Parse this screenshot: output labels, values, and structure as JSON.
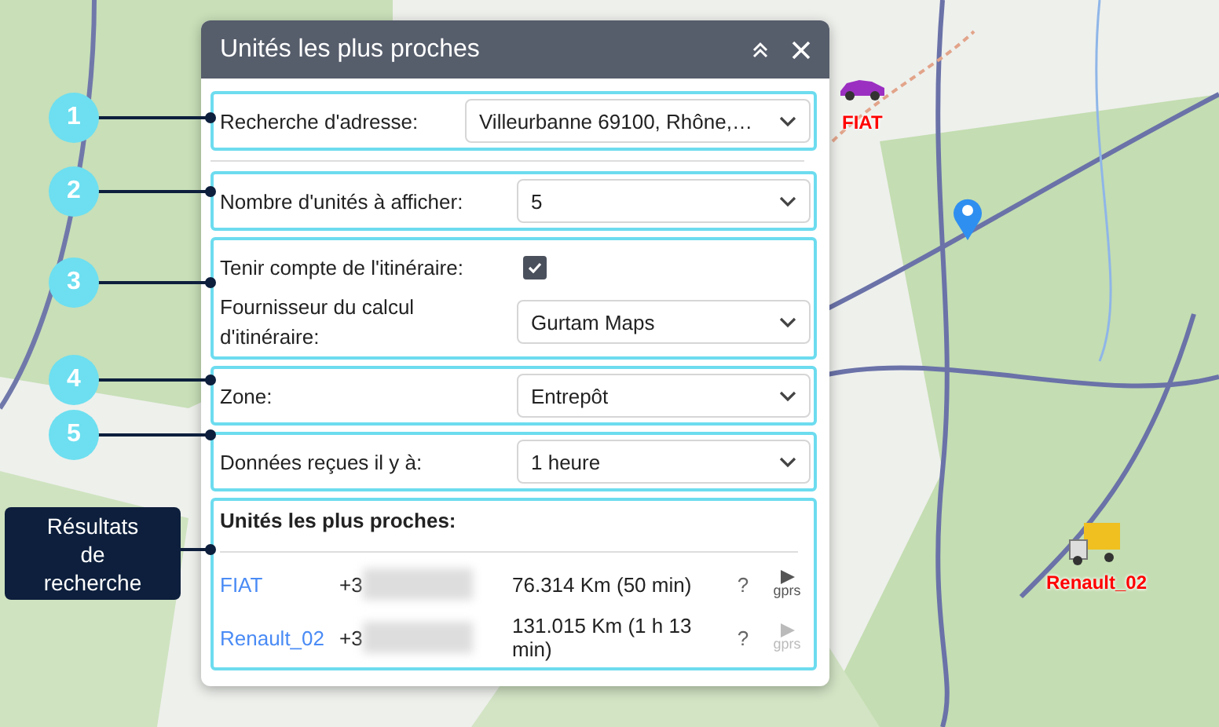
{
  "map_markers": [
    {
      "kind": "car",
      "label": "FIAT"
    },
    {
      "kind": "truck",
      "label": "Renault_02"
    }
  ],
  "panel": {
    "title": "Unités les plus proches"
  },
  "sections": [
    {
      "callout": "1",
      "rows": [
        {
          "kind": "select",
          "label": "Recherche d'adresse:",
          "value": "Villeurbanne 69100, Rhône,…",
          "wide": true
        }
      ]
    },
    {
      "callout": "2",
      "rows": [
        {
          "kind": "select",
          "label": "Nombre d'unités à afficher:",
          "value": "5"
        }
      ]
    },
    {
      "callout": "3",
      "rows": [
        {
          "kind": "checkbox",
          "label": "Tenir compte de l'itinéraire:",
          "checked": true
        },
        {
          "kind": "select",
          "label": "Fournisseur du calcul d'itinéraire:",
          "value": "Gurtam Maps"
        }
      ]
    },
    {
      "callout": "4",
      "rows": [
        {
          "kind": "select",
          "label": "Zone:",
          "value": "Entrepôt"
        }
      ]
    },
    {
      "callout": "5",
      "rows": [
        {
          "kind": "select",
          "label": "Données reçues il y à:",
          "value": "1 heure"
        }
      ]
    }
  ],
  "results": {
    "callout_label": "Résultats de recherche",
    "title": "Unités les plus proches:",
    "units": [
      {
        "name": "FIAT",
        "phone": "+3",
        "distance": "76.314 Km (50 min)",
        "help": "?",
        "command_label": "gprs",
        "command_enabled": true
      },
      {
        "name": "Renault_02",
        "phone": "+3",
        "distance": "131.015 Km (1 h 13 min)",
        "help": "?",
        "command_label": "gprs",
        "command_enabled": false
      }
    ]
  }
}
